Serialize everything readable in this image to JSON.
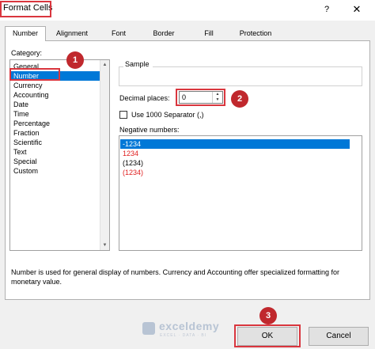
{
  "window": {
    "title": "Format Cells",
    "help_label": "?",
    "close_label": "✕"
  },
  "tabs": [
    {
      "label": "Number"
    },
    {
      "label": "Alignment"
    },
    {
      "label": "Font"
    },
    {
      "label": "Border"
    },
    {
      "label": "Fill"
    },
    {
      "label": "Protection"
    }
  ],
  "category": {
    "label": "Category:",
    "items": [
      "General",
      "Number",
      "Currency",
      "Accounting",
      "Date",
      "Time",
      "Percentage",
      "Fraction",
      "Scientific",
      "Text",
      "Special",
      "Custom"
    ],
    "selected": "Number"
  },
  "sample": {
    "label": "Sample"
  },
  "decimal_places": {
    "label": "Decimal places:",
    "value": "0"
  },
  "separator": {
    "label": "Use 1000 Separator (,)",
    "checked": false
  },
  "negative_numbers": {
    "label": "Negative numbers:",
    "items": [
      {
        "text": "-1234",
        "color": "#ffffff",
        "selected": true
      },
      {
        "text": "1234",
        "color": "#e02020",
        "selected": false
      },
      {
        "text": "(1234)",
        "color": "#000000",
        "selected": false
      },
      {
        "text": "(1234)",
        "color": "#e02020",
        "selected": false
      }
    ]
  },
  "description": "Number is used for general display of numbers.  Currency and Accounting offer specialized formatting for monetary value.",
  "watermark": {
    "name": "exceldemy",
    "tagline": "EXCEL · DATA · BI"
  },
  "buttons": {
    "ok": "OK",
    "cancel": "Cancel"
  },
  "annotations": {
    "step1": "1",
    "step2": "2",
    "step3": "3",
    "highlight_color": "#d9363e"
  }
}
